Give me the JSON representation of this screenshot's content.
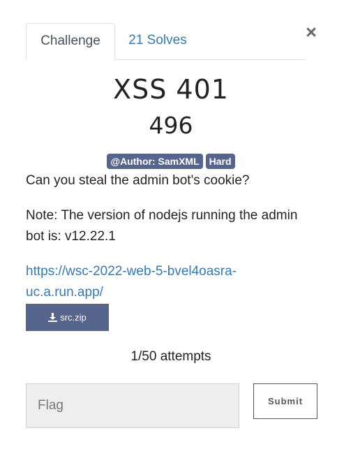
{
  "tabs": {
    "challenge_label": "Challenge",
    "solves_label": "21 Solves"
  },
  "close_glyph": "×",
  "challenge": {
    "name": "XSS 401",
    "value": "496",
    "tags": [
      "@Author: SamXML",
      "Hard"
    ],
    "description_1": "Can you steal the admin bot's cookie?",
    "description_2": "Note: The version of nodejs running the admin bot is: v12.22.1",
    "link": "https://wsc-2022-web-5-bvel4oasra-uc.a.run.app/",
    "file_label": "src.zip"
  },
  "attempts_text": "1/50 attempts",
  "form": {
    "flag_placeholder": "Flag",
    "flag_value": "",
    "submit_label": "Submit"
  },
  "colors": {
    "accent": "#337ab7",
    "tag_bg": "#56658d"
  },
  "icons": {
    "file": "download-icon",
    "close": "close-icon"
  }
}
